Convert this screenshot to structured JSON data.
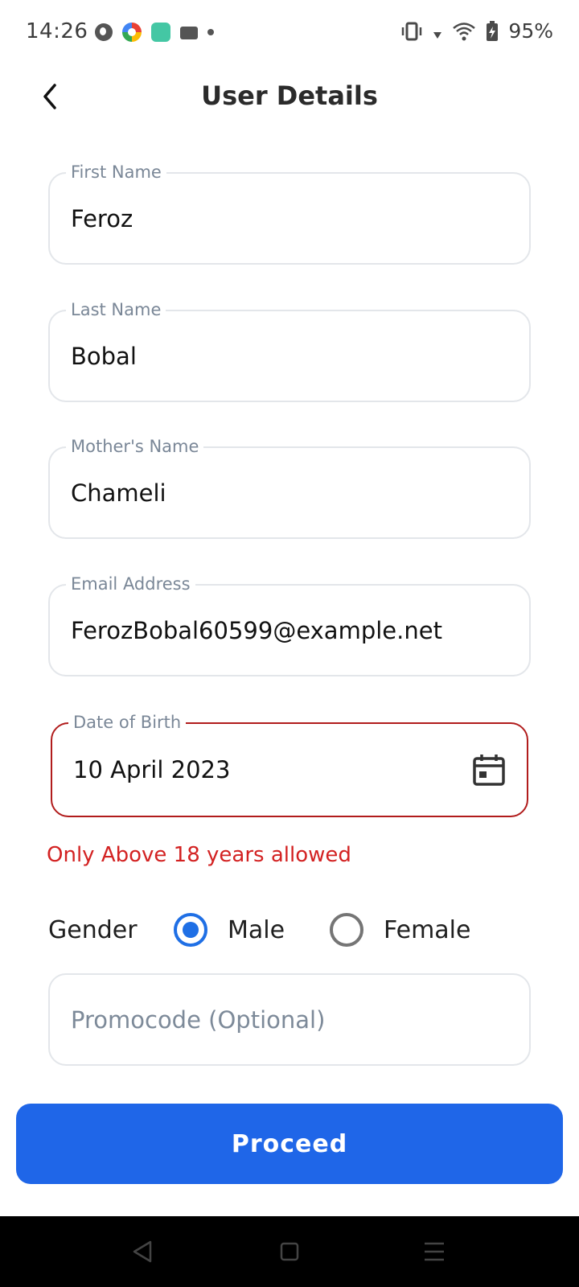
{
  "status_bar": {
    "time": "14:26",
    "battery": "95%",
    "icons": [
      "notification-app-icon",
      "color-app-icon",
      "teal-app-icon",
      "card-app-icon",
      "more-dot-icon",
      "vibrate-icon",
      "signal-icon",
      "wifi-icon",
      "battery-charging-icon"
    ]
  },
  "header": {
    "title": "User Details",
    "back_icon": "chevron-left-icon"
  },
  "form": {
    "first_name": {
      "label": "First Name",
      "value": "Feroz"
    },
    "last_name": {
      "label": "Last Name",
      "value": "Bobal"
    },
    "mother_name": {
      "label": "Mother's Name",
      "value": "Chameli"
    },
    "email": {
      "label": "Email Address",
      "value": "FerozBobal60599@example.net"
    },
    "dob": {
      "label": "Date of Birth",
      "value": "10 April 2023",
      "error": "Only Above 18 years allowed",
      "icon": "calendar-icon"
    },
    "gender": {
      "label": "Gender",
      "options": [
        "Male",
        "Female"
      ],
      "selected": "Male"
    },
    "promocode": {
      "placeholder": "Promocode (Optional)"
    }
  },
  "proceed_label": "Proceed",
  "colors": {
    "primary": "#1f66e8",
    "error": "#d32222",
    "error_border": "#b11c1c",
    "radio_selected": "#1f6fe5",
    "field_border": "#e3e6ea",
    "label": "#7a8797"
  },
  "nav_bar": {
    "icons": [
      "back-nav-icon",
      "home-nav-icon",
      "recents-nav-icon"
    ]
  }
}
